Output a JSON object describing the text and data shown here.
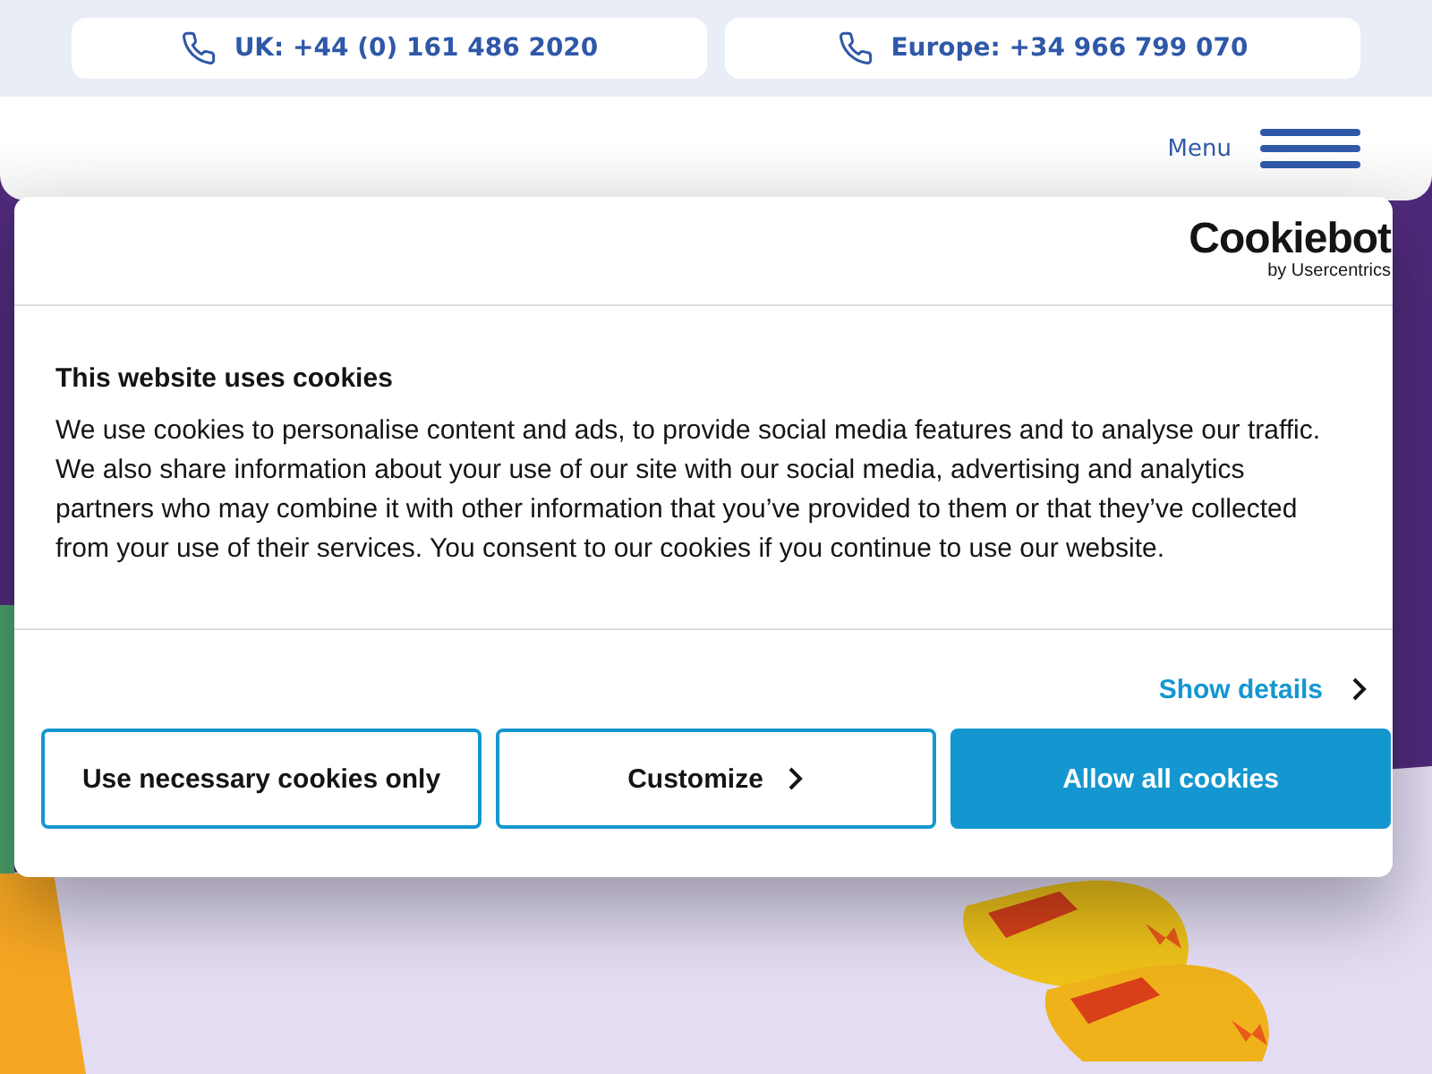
{
  "contact_bar": [
    {
      "label": "UK: +44 (0) 161 486 2020"
    },
    {
      "label": "Europe: +34 966 799 070"
    }
  ],
  "header": {
    "menu_label": "Menu"
  },
  "cookie_dialog": {
    "logo": {
      "name": "Cookiebot",
      "byline": "by Usercentrics"
    },
    "title": "This website uses cookies",
    "body": "We use cookies to personalise content and ads, to provide social media features and to analyse our traffic. We also share information about your use of our site with our social media, advertising and analytics partners who may combine it with other information that you’ve provided to them or that they’ve collected from your use of their services. You consent to our cookies if you continue to use our website.",
    "details_link": "Show details",
    "buttons": [
      {
        "label": "Use necessary cookies only",
        "kind": "outline"
      },
      {
        "label": "Customize",
        "kind": "chevron"
      },
      {
        "label": "Allow all cookies",
        "kind": "primary"
      }
    ]
  }
}
